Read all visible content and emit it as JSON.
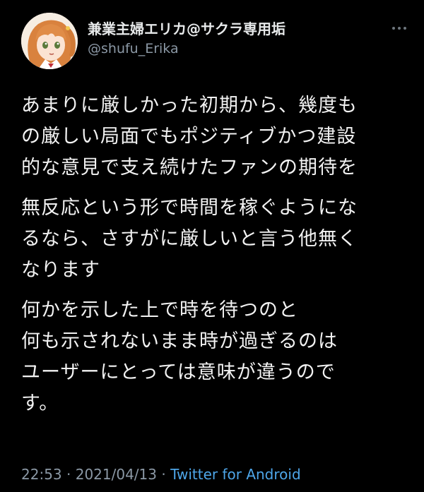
{
  "user": {
    "display_name": "兼業主婦エリカ@サクラ専用垢",
    "handle": "@shufu_Erika"
  },
  "tweet": {
    "paragraphs": [
      [
        "あまりに厳しかった初期から、幾度も",
        "の厳しい局面でもポジティブかつ建設",
        "的な意見で支え続けたファンの期待を"
      ],
      [
        "無反応という形で時間を稼ぐようにな",
        "るなら、さすがに厳しいと言う他無く",
        "なります"
      ],
      [
        "何かを示した上で時を待つのと",
        "何も示されないまま時が過ぎるのは",
        "ユーザーにとっては意味が違うので",
        "す。"
      ]
    ]
  },
  "meta": {
    "time": "22:53",
    "separator1": " · ",
    "date": "2021/04/13",
    "separator2": " · ",
    "source": "Twitter for Android"
  },
  "colors": {
    "background": "#000000",
    "text": "#f2f2f2",
    "muted": "#8b98a5",
    "link": "#4ea6e9"
  },
  "icons": {
    "more": "more-horizontal-icon",
    "avatar": "profile-avatar"
  }
}
